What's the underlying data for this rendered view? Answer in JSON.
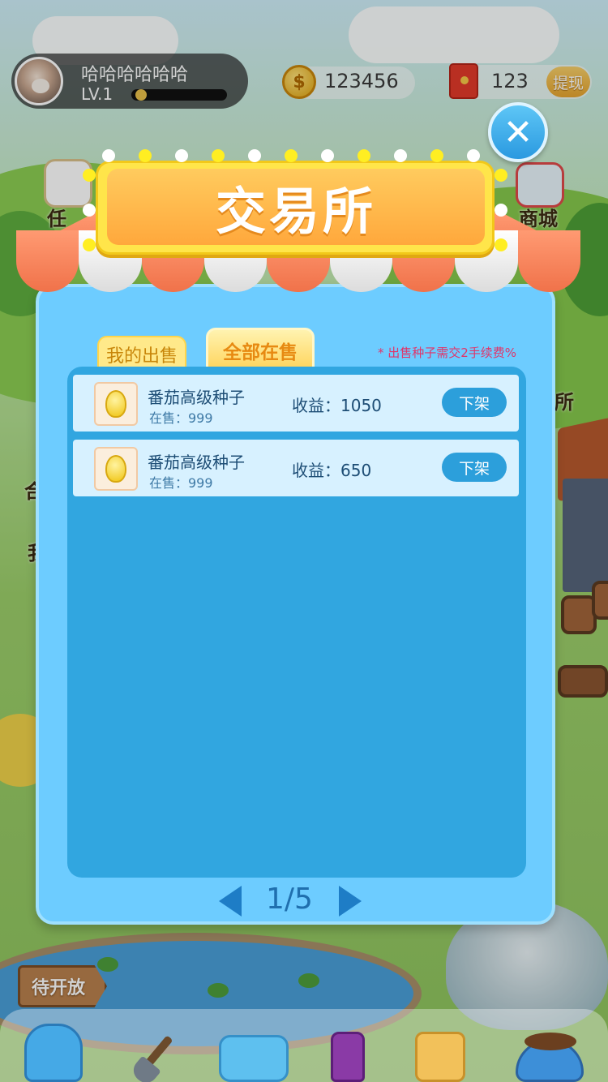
{
  "hud": {
    "nickname": "哈哈哈哈哈哈",
    "level": "LV.1",
    "level_progress": 0.05,
    "coins": "123456",
    "red_packets": "123",
    "withdraw_label": "提现"
  },
  "scene": {
    "left_labels": [
      "任",
      "合",
      "我"
    ],
    "right_labels": [
      "商城",
      "所"
    ],
    "sign_label": "待开放"
  },
  "modal": {
    "title": "交易所",
    "close_symbol": "✕",
    "tabs": [
      {
        "label": "我的出售",
        "active": false
      },
      {
        "label": "全部在售",
        "active": true
      }
    ],
    "fee_note": "* 出售种子需交2手续费%",
    "listings": [
      {
        "name": "番茄高级种子",
        "stock": "在售：999",
        "income": "收益：1050",
        "action": "下架"
      },
      {
        "name": "番茄高级种子",
        "stock": "在售：999",
        "income": "收益：650",
        "action": "下架"
      }
    ],
    "pagination": {
      "current": "1/5"
    }
  },
  "colors": {
    "panel": "#6dccff",
    "list_bg": "#31a6e0",
    "row_bg": "#d7f1ff",
    "action_button": "#2c9fdb",
    "title_text": "#ffffff",
    "fee_note": "#e0356a"
  },
  "toolbar": {
    "items": [
      {
        "icon": "backpack-icon",
        "label": "背包"
      },
      {
        "icon": "shovel-icon"
      },
      {
        "icon": "watering-can-icon"
      },
      {
        "icon": "poison-bottle-icon"
      },
      {
        "icon": "seed-bag-icon"
      },
      {
        "icon": "pet-bowl-icon"
      }
    ]
  }
}
